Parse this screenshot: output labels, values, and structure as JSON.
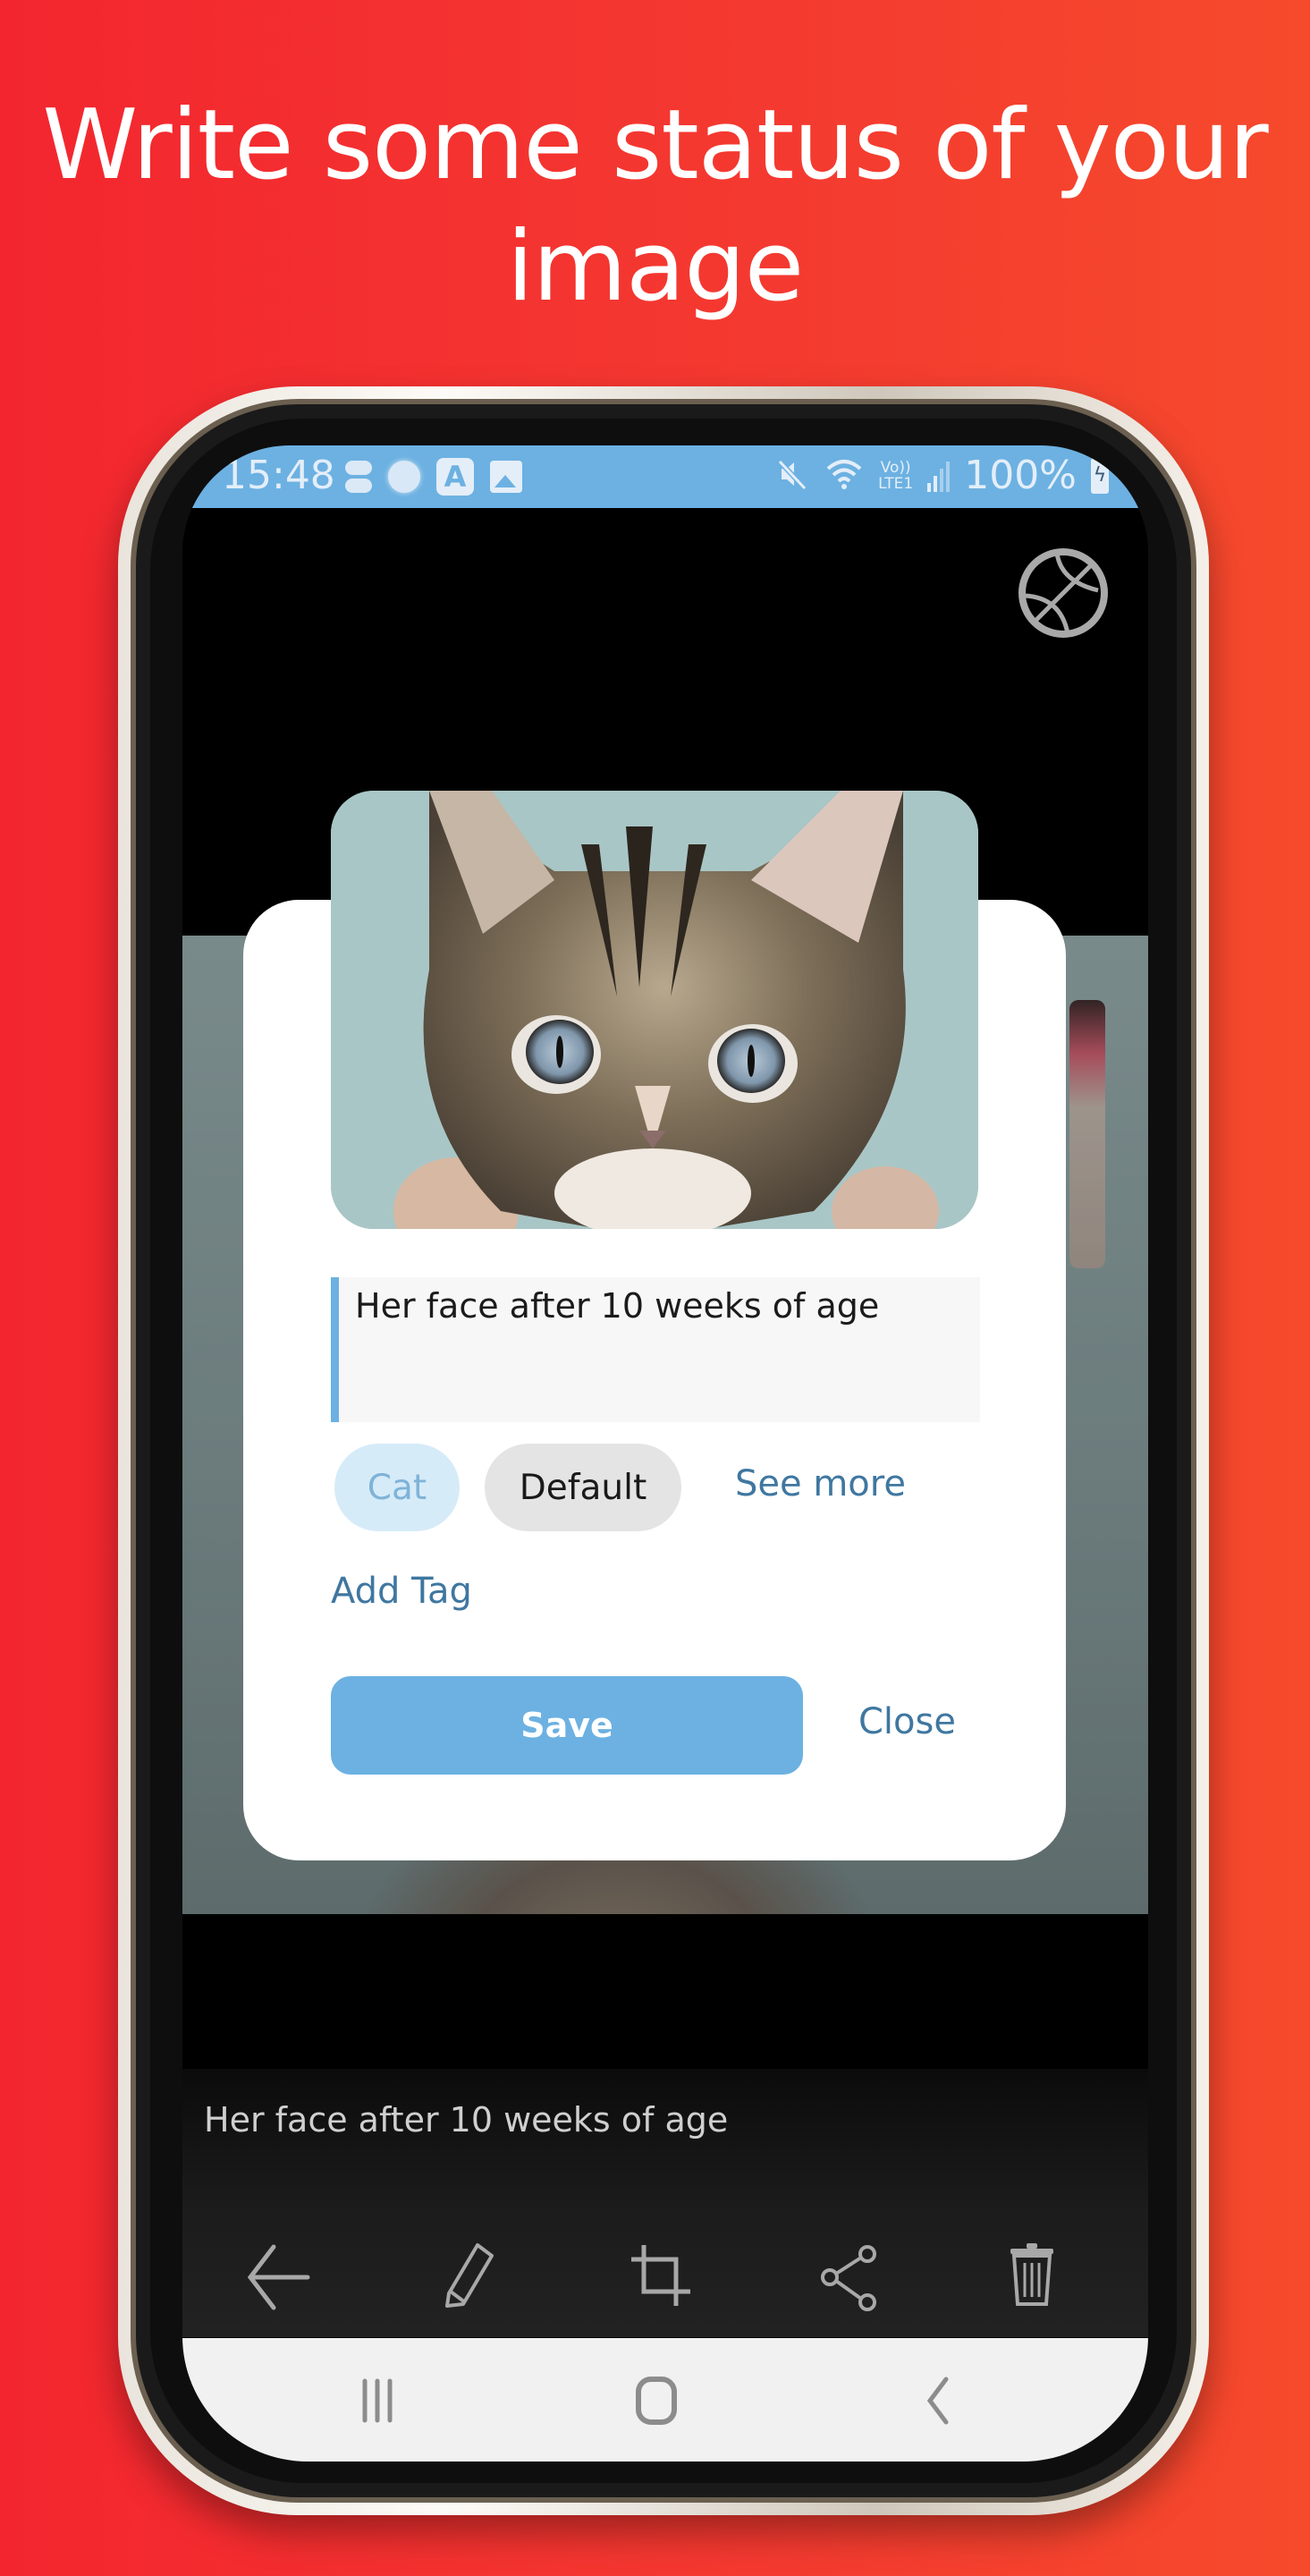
{
  "headline": {
    "line1": "Write some status of your",
    "line2": "image"
  },
  "status_bar": {
    "time": "15:48",
    "left_icons": [
      "toggle-icon",
      "dot-icon",
      "app-a-icon",
      "gallery-icon"
    ],
    "right_icons": [
      "mute-icon",
      "wifi-icon",
      "volte-lte-icon",
      "signal-icon",
      "battery-charging-icon"
    ],
    "lte_top": "Vo))",
    "lte_bottom": "LTE1",
    "battery_percent": "100%",
    "color": "#6cb1e2"
  },
  "viewer": {
    "top_right_icon": "globe-icon"
  },
  "dialog": {
    "photo_alt": "Kitten face",
    "caption_value": "Her face after 10 weeks of age",
    "caption_placeholder": "",
    "tags": [
      {
        "label": "Cat",
        "selected": true
      },
      {
        "label": "Default",
        "selected": false
      }
    ],
    "see_more_label": "See more",
    "add_tag_label": "Add Tag",
    "save_label": "Save",
    "close_label": "Close",
    "accent_color": "#6cb1e2",
    "link_color": "#3f77a0"
  },
  "bottom": {
    "caption": "Her face after 10 weeks of age",
    "toolbar": [
      {
        "name": "back",
        "icon": "arrow-left-icon"
      },
      {
        "name": "edit",
        "icon": "pencil-icon"
      },
      {
        "name": "crop",
        "icon": "crop-icon"
      },
      {
        "name": "share",
        "icon": "share-icon"
      },
      {
        "name": "delete",
        "icon": "trash-icon"
      }
    ]
  },
  "system_nav": {
    "buttons": [
      {
        "name": "recents",
        "icon": "recents-icon"
      },
      {
        "name": "home",
        "icon": "home-icon"
      },
      {
        "name": "back",
        "icon": "back-chevron-icon"
      }
    ]
  }
}
